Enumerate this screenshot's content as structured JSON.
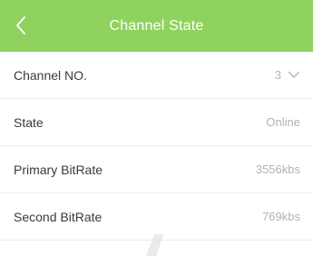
{
  "header": {
    "title": "Channel State",
    "back_icon": "chevron-left-icon",
    "background_color": "#8fd35e"
  },
  "rows": [
    {
      "label": "Channel NO.",
      "value": "3",
      "icon": "chevron-down-icon"
    },
    {
      "label": "State",
      "value": "Online"
    },
    {
      "label": "Primary BitRate",
      "value": "3556kbs"
    },
    {
      "label": "Second BitRate",
      "value": "769kbs"
    }
  ]
}
